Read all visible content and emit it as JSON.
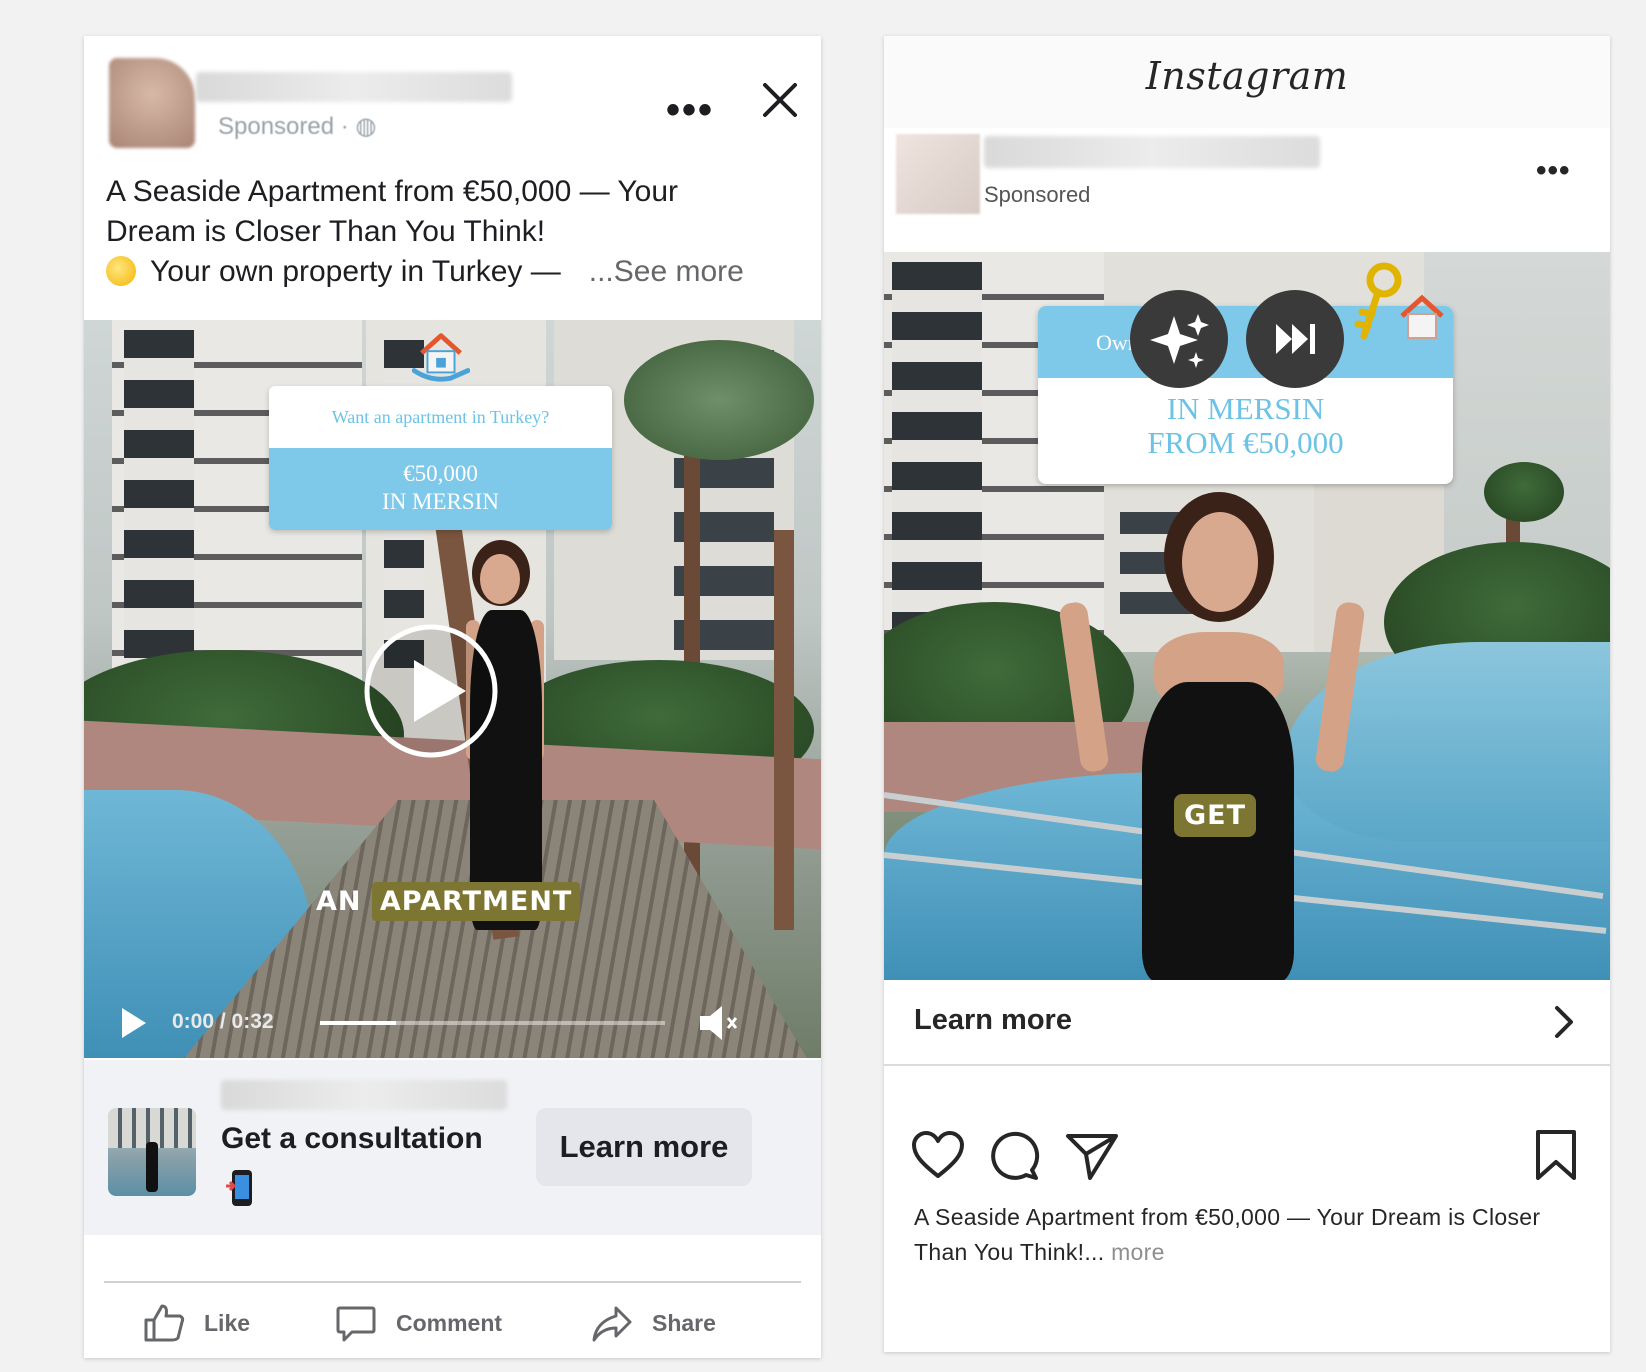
{
  "facebook": {
    "sponsored": "Sponsored · ◍",
    "post_text": {
      "line1": "A Seaside Apartment from €50,000 — Your",
      "line2": "Dream is Closer Than You Think!",
      "line3": "Your own property in Turkey —",
      "see_more": "...See more"
    },
    "video": {
      "overlay_top": "Want an apartment in Turkey?",
      "overlay_line1": "€50,000",
      "overlay_line2": "IN MERSIN",
      "caption_plain": "AN",
      "caption_highlight": "APARTMENT",
      "time": "0:00 / 0:32",
      "progress": 0.22
    },
    "cta": {
      "title": "Get a consultation",
      "button": "Learn more"
    },
    "actions": {
      "like": "Like",
      "comment": "Comment",
      "share": "Share"
    }
  },
  "instagram": {
    "logo": "Instagram",
    "sponsored": "Sponsored",
    "video": {
      "overlay_band": "Own",
      "overlay_line1": "IN MERSIN",
      "overlay_line2": "FROM €50,000",
      "caption_highlight": "GET"
    },
    "learn_more": "Learn more",
    "caption": {
      "text": "A Seaside Apartment from €50,000 — Your Dream is Closer Than You Think!...",
      "more": "more"
    }
  },
  "colors": {
    "fb_text": "#1c1e21",
    "fb_muted": "#65676b",
    "overlay_blue": "#7ec8e9",
    "caption_highlight": "#7d7532"
  }
}
